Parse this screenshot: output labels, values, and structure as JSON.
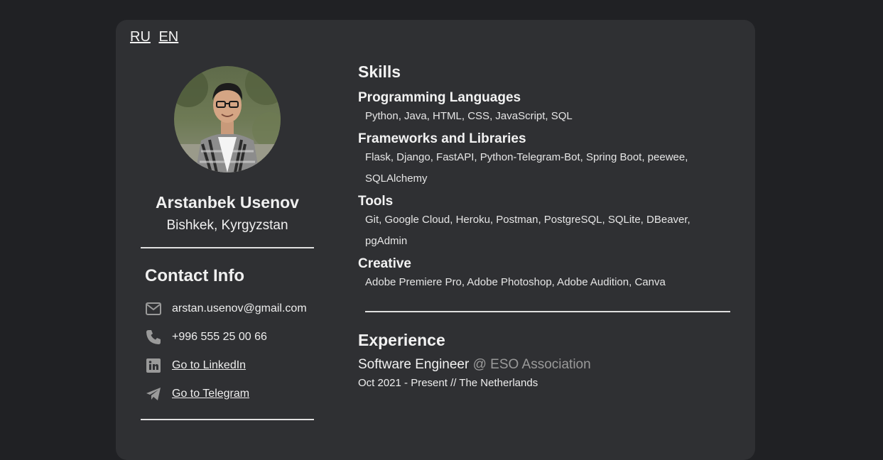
{
  "lang": {
    "ru": "RU",
    "en": "EN"
  },
  "profile": {
    "name": "Arstanbek Usenov",
    "location": "Bishkek, Kyrgyzstan"
  },
  "contact": {
    "heading": "Contact Info",
    "email": "arstan.usenov@gmail.com",
    "phone": "+996 555 25 00 66",
    "linkedin": "Go to LinkedIn",
    "telegram": "Go to Telegram"
  },
  "skills": {
    "heading": "Skills",
    "groups": [
      {
        "title": "Programming Languages",
        "text": "Python, Java, HTML, CSS, JavaScript, SQL"
      },
      {
        "title": "Frameworks and Libraries",
        "text": "Flask, Django, FastAPI, Python-Telegram-Bot, Spring Boot, peewee, SQLAlchemy"
      },
      {
        "title": "Tools",
        "text": "Git, Google Cloud, Heroku, Postman, PostgreSQL, SQLite, DBeaver, pgAdmin"
      },
      {
        "title": "Creative",
        "text": "Adobe Premiere Pro, Adobe Photoshop, Adobe Audition, Canva"
      }
    ]
  },
  "experience": {
    "heading": "Experience",
    "jobs": [
      {
        "title": "Software Engineer",
        "company": "@ ESO Association",
        "meta": "Oct 2021 - Present // The Netherlands"
      }
    ]
  },
  "icons": {
    "email": "envelope-icon",
    "phone": "phone-icon",
    "linkedin": "linkedin-icon",
    "telegram": "telegram-icon"
  }
}
